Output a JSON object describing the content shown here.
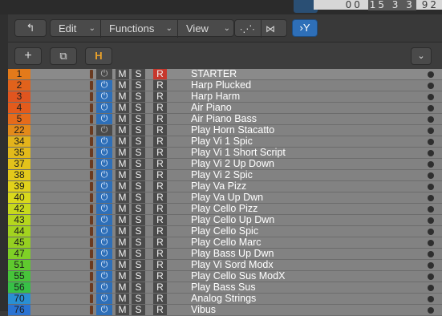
{
  "lcd": {
    "text_a": "00",
    "text_b": "15 3 3",
    "text_c": "92"
  },
  "toolbar": {
    "back_icon": "back-arrow-icon",
    "edit_label": "Edit",
    "functions_label": "Functions",
    "view_label": "View",
    "automation_icon": "automation-curve-icon",
    "flex_icon": "flex-icon",
    "catch_icon": "catch-playhead-icon",
    "accent": "#2e6fb8"
  },
  "controls": {
    "add_label": "+",
    "duplicate_icon": "duplicate-track-icon",
    "hide_label": "H",
    "hide_color": "#e9a12a",
    "collapse_icon": "chevron-down-icon"
  },
  "tracks": [
    {
      "num": "1",
      "color": "#e37a1a",
      "name": "STARTER",
      "power": "off",
      "armed": true
    },
    {
      "num": "2",
      "color": "#e1621b",
      "name": "Harp Plucked",
      "power": "on",
      "armed": false
    },
    {
      "num": "3",
      "color": "#e0551f",
      "name": "Harp Harm",
      "power": "on",
      "armed": false
    },
    {
      "num": "4",
      "color": "#e35b1c",
      "name": "Air Piano",
      "power": "on",
      "armed": false
    },
    {
      "num": "5",
      "color": "#e56b1b",
      "name": "Air Piano Bass",
      "power": "on",
      "armed": false
    },
    {
      "num": "22",
      "color": "#e38a1a",
      "name": "Play  Horn Stacatto",
      "power": "off",
      "armed": false
    },
    {
      "num": "34",
      "color": "#e3b31b",
      "name": "Play Vi 1 Spic",
      "power": "on",
      "armed": false
    },
    {
      "num": "35",
      "color": "#e3ba1b",
      "name": "Play Vi 1 Short Script",
      "power": "on",
      "armed": false
    },
    {
      "num": "37",
      "color": "#e3c21b",
      "name": "Play Vi 2 Up Down",
      "power": "on",
      "armed": false
    },
    {
      "num": "38",
      "color": "#e3c91b",
      "name": "Play Vi 2 Spic",
      "power": "on",
      "armed": false
    },
    {
      "num": "39",
      "color": "#e1d21b",
      "name": "Play Va Pizz",
      "power": "on",
      "armed": false
    },
    {
      "num": "40",
      "color": "#d9d91c",
      "name": "Play Va Up Dwn",
      "power": "on",
      "armed": false
    },
    {
      "num": "42",
      "color": "#c7d91d",
      "name": "Play Cello Pizz",
      "power": "on",
      "armed": false
    },
    {
      "num": "43",
      "color": "#b5d61e",
      "name": "Play Cello Up Dwn",
      "power": "on",
      "armed": false
    },
    {
      "num": "44",
      "color": "#a3d31f",
      "name": "Play Cello Spic",
      "power": "on",
      "armed": false
    },
    {
      "num": "45",
      "color": "#95d021",
      "name": "Play Cello Marc",
      "power": "on",
      "armed": false
    },
    {
      "num": "47",
      "color": "#7fd026",
      "name": "Play Bass Up Dwn",
      "power": "on",
      "armed": false
    },
    {
      "num": "51",
      "color": "#5fca2e",
      "name": "Play Vi Sord Modx",
      "power": "on",
      "armed": false
    },
    {
      "num": "55",
      "color": "#47c43a",
      "name": "Play Cello Sus ModX",
      "power": "on",
      "armed": false
    },
    {
      "num": "56",
      "color": "#37c046",
      "name": "Play Bass Sus",
      "power": "on",
      "armed": false
    },
    {
      "num": "70",
      "color": "#2a8fd2",
      "name": "Analog Strings",
      "power": "on",
      "armed": false
    },
    {
      "num": "76",
      "color": "#2a73d2",
      "name": "Vibus",
      "power": "on",
      "armed": false
    }
  ],
  "labels": {
    "mute": "M",
    "solo": "S",
    "record": "R",
    "power_glyph": "⏻"
  }
}
